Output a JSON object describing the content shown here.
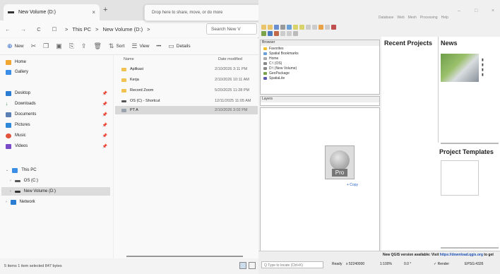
{
  "explorer": {
    "tab_title": "New Volume (D:)",
    "tab_close": "×",
    "new_tab": "+",
    "nav": {
      "back": "←",
      "forward": "→",
      "refresh": "C",
      "view": "☐",
      "crumb_sep": ">",
      "crumb_1": "This PC",
      "crumb_2": "New Volume (D:)",
      "crumb_end": ">"
    },
    "search_placeholder": "Search New V",
    "commands": {
      "new": "New",
      "sort": "Sort",
      "view": "View",
      "more": "•••",
      "details": "Details"
    },
    "sidebar": {
      "home": "Home",
      "gallery": "Gallery",
      "desktop": "Desktop",
      "downloads": "Downloads",
      "documents": "Documents",
      "pictures": "Pictures",
      "music": "Music",
      "videos": "Videos",
      "this_pc": "This PC",
      "os_c": "OS (C:)",
      "new_volume": "New Volume (D:)",
      "network": "Network"
    },
    "columns": {
      "name": "Name",
      "date": "Date modified"
    },
    "files": [
      {
        "name": "Aplikasi",
        "date": "2/10/2026 3:11 PM"
      },
      {
        "name": "Kerja",
        "date": "2/10/2026 10:11 AM"
      },
      {
        "name": "Record Zoom",
        "date": "5/20/2025 11:28 PM"
      },
      {
        "name": "OS (C) - Shortcut",
        "date": "12/11/2025 11:05 AM"
      },
      {
        "name": "PT A",
        "date": "2/10/2026 3:02 PM"
      }
    ],
    "status_text": "5 items    1 item selected  847 bytes"
  },
  "drop_hint": "Drop here to share, move, or do more",
  "qgis": {
    "menus": [
      "Database",
      "Web",
      "Mesh",
      "Processing",
      "Help"
    ],
    "window_controls": {
      "min": "–",
      "max": "□",
      "close": "×"
    },
    "browser": {
      "title": "Browser",
      "items": [
        "Favorites",
        "Spatial Bookmarks",
        "Home",
        "C:\\ (OS)",
        "D:\\ (New Volume)",
        "GeoPackage",
        "SpatiaLite"
      ]
    },
    "layers_title": "Layers",
    "drag_label": "Pro",
    "copy_label": "+ Copy",
    "welcome": {
      "recent": "Recent Projects",
      "news": "News",
      "templates": "Project Templates"
    },
    "status": {
      "news_prefix": "New QGIS version available: Visit",
      "news_link": "https://download.qgis.org",
      "news_suffix": "to get",
      "locate_placeholder": "Q  Type to locate (Ctrl+K)",
      "ready": "Ready",
      "coordinate": "x 52240000",
      "scale": "1:100%",
      "rotation": "0.0 °",
      "render": "✓ Render",
      "crs": "EPSG:4326"
    }
  }
}
